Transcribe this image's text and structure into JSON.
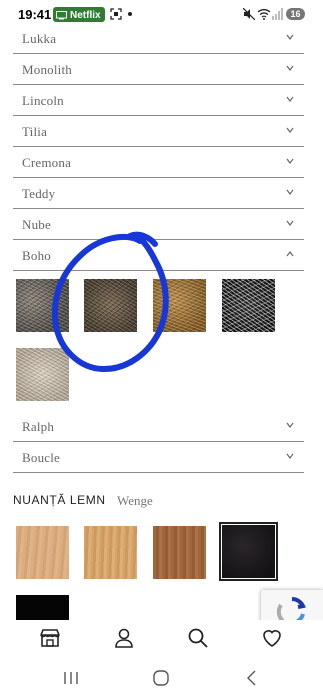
{
  "status_bar": {
    "time": "19:41",
    "netflix_label": "Netflix",
    "battery": "16"
  },
  "accordion": [
    {
      "label": "Lukka",
      "expanded": false
    },
    {
      "label": "Monolith",
      "expanded": false
    },
    {
      "label": "Lincoln",
      "expanded": false
    },
    {
      "label": "Tilia",
      "expanded": false
    },
    {
      "label": "Cremona",
      "expanded": false
    },
    {
      "label": "Teddy",
      "expanded": false
    },
    {
      "label": "Nube",
      "expanded": false
    },
    {
      "label": "Boho",
      "expanded": true
    },
    {
      "label": "Ralph",
      "expanded": false
    },
    {
      "label": "Boucle",
      "expanded": false
    }
  ],
  "boho_swatches": [
    {
      "name": "boho-swatch-1",
      "color": "#5f5a54"
    },
    {
      "name": "boho-swatch-2",
      "color": "#5a4e40"
    },
    {
      "name": "boho-swatch-3",
      "color": "#9a713c"
    },
    {
      "name": "boho-swatch-4",
      "color": "#1c1c1c"
    },
    {
      "name": "boho-swatch-5",
      "color": "#bdb2a0"
    }
  ],
  "wood_section": {
    "title": "NUANȚĂ LEMN",
    "selected_value": "Wenge",
    "swatches": [
      {
        "name": "wood-swatch-1",
        "color": "#d9a97a",
        "selected": false
      },
      {
        "name": "wood-swatch-2",
        "color": "#d3a068",
        "selected": false
      },
      {
        "name": "wood-swatch-3",
        "color": "#9d643a",
        "selected": false
      },
      {
        "name": "wood-swatch-wenge",
        "color": "#1c191c",
        "selected": true
      },
      {
        "name": "wood-swatch-5",
        "color": "#050505",
        "selected": false
      }
    ]
  },
  "bottom_nav": {
    "items": [
      {
        "icon": "store-icon"
      },
      {
        "icon": "user-icon"
      },
      {
        "icon": "search-icon"
      },
      {
        "icon": "heart-icon"
      }
    ]
  },
  "annotation": {
    "color": "#1737d6"
  },
  "colors": {
    "divider": "#8a8a8a",
    "label": "#666666",
    "netflix_badge": "#2e7d32"
  }
}
